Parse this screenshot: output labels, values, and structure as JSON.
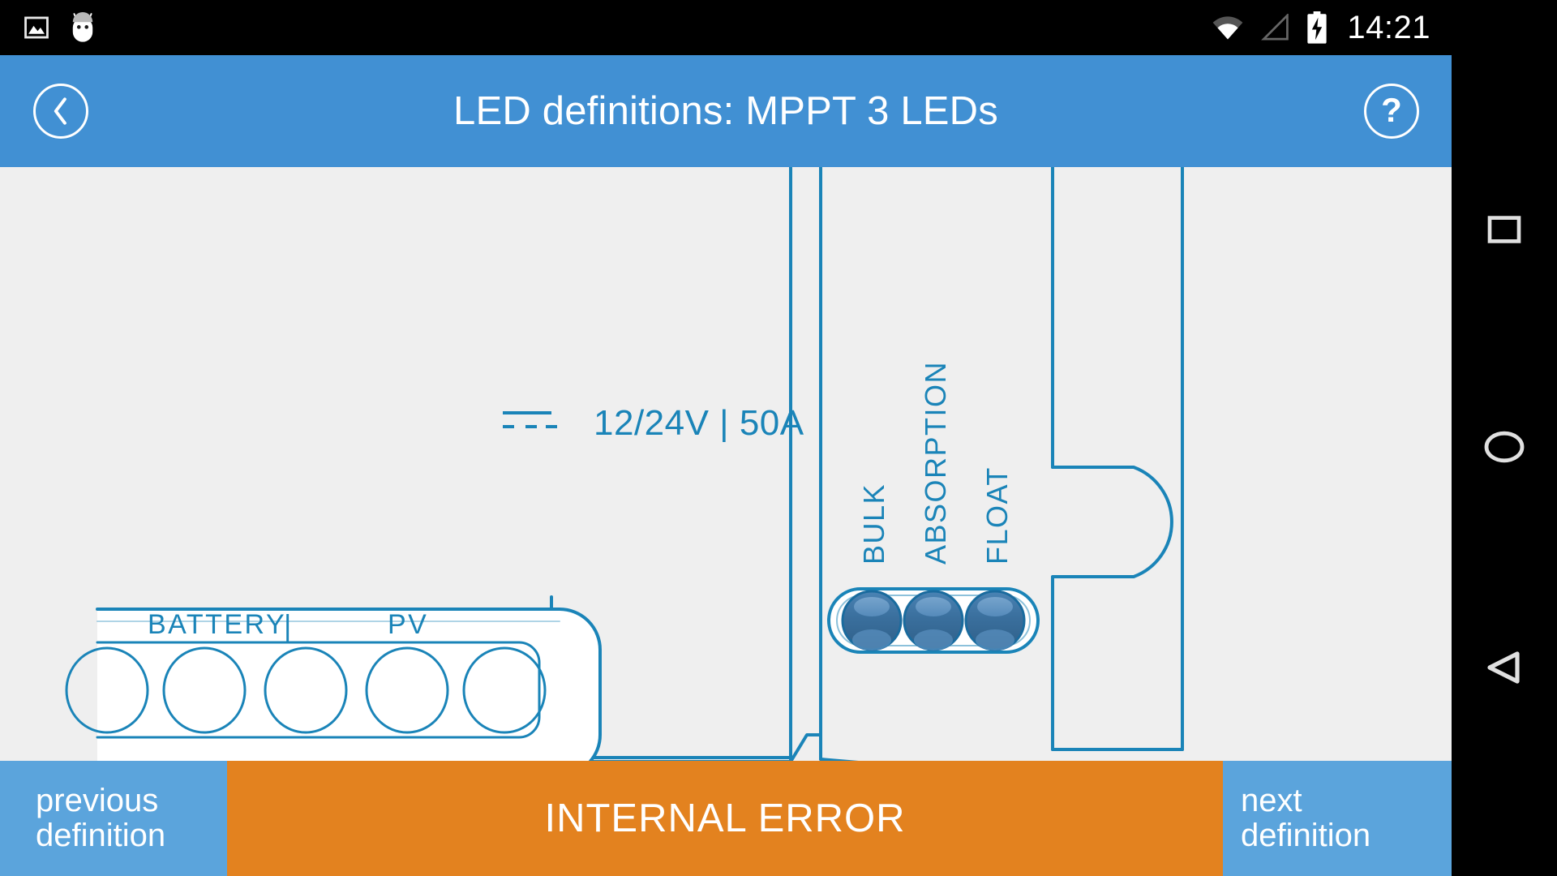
{
  "status_bar": {
    "time": "14:21",
    "icons": [
      "screenshot-image-icon",
      "android-mascot-icon",
      "wifi-icon",
      "cellular-signal-icon",
      "battery-charging-icon"
    ],
    "background_color": "#000000",
    "text_color": "#ffffff"
  },
  "app_bar": {
    "title": "LED definitions: MPPT 3 LEDs",
    "back_label": "‹",
    "help_label": "?",
    "background_color": "#4190d3"
  },
  "content": {
    "background_color": "#efefef",
    "line_color": "#1a84b8",
    "device": {
      "rating_text": "12/24V | 50A",
      "dc_symbol": "dc-power-symbol",
      "terminal_block": {
        "group_labels": [
          "BATTERY",
          "|",
          "PV"
        ],
        "polarity_symbols": [
          "+",
          "–",
          "|",
          "–",
          "+"
        ],
        "terminal_count": 5
      },
      "leds": [
        {
          "label": "BULK",
          "state": "off",
          "color": "#3b77a8"
        },
        {
          "label": "ABSORPTION",
          "state": "off",
          "color": "#3b77a8"
        },
        {
          "label": "FLOAT",
          "state": "off",
          "color": "#3b77a8"
        }
      ]
    }
  },
  "bottom_bar": {
    "previous_line1": "previous",
    "previous_line2": "definition",
    "status_text": "INTERNAL ERROR",
    "next_line1": "next",
    "next_line2": "definition",
    "nav_background_color": "#5ba4dc",
    "status_background_color": "#e3821f"
  },
  "nav_bar": {
    "buttons": [
      "recents-square-icon",
      "home-circle-icon",
      "back-triangle-icon"
    ],
    "background_color": "#000000"
  }
}
